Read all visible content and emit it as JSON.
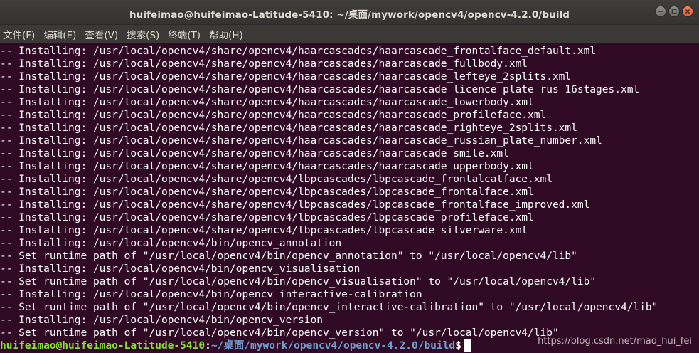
{
  "window": {
    "title": "huifeimao@huifeimao-Latitude-5410: ~/桌面/mywork/opencv4/opencv-4.2.0/build",
    "buttons": [
      {
        "icon": "minimize-icon"
      },
      {
        "icon": "maximize-icon"
      },
      {
        "icon": "close-icon"
      }
    ]
  },
  "menubar": {
    "items": [
      "文件(F)",
      "编辑(E)",
      "查看(V)",
      "搜索(S)",
      "终端(T)",
      "帮助(H)"
    ]
  },
  "terminal": {
    "lines": [
      "-- Installing: /usr/local/opencv4/share/opencv4/haarcascades/haarcascade_frontalface_default.xml",
      "-- Installing: /usr/local/opencv4/share/opencv4/haarcascades/haarcascade_fullbody.xml",
      "-- Installing: /usr/local/opencv4/share/opencv4/haarcascades/haarcascade_lefteye_2splits.xml",
      "-- Installing: /usr/local/opencv4/share/opencv4/haarcascades/haarcascade_licence_plate_rus_16stages.xml",
      "-- Installing: /usr/local/opencv4/share/opencv4/haarcascades/haarcascade_lowerbody.xml",
      "-- Installing: /usr/local/opencv4/share/opencv4/haarcascades/haarcascade_profileface.xml",
      "-- Installing: /usr/local/opencv4/share/opencv4/haarcascades/haarcascade_righteye_2splits.xml",
      "-- Installing: /usr/local/opencv4/share/opencv4/haarcascades/haarcascade_russian_plate_number.xml",
      "-- Installing: /usr/local/opencv4/share/opencv4/haarcascades/haarcascade_smile.xml",
      "-- Installing: /usr/local/opencv4/share/opencv4/haarcascades/haarcascade_upperbody.xml",
      "-- Installing: /usr/local/opencv4/share/opencv4/lbpcascades/lbpcascade_frontalcatface.xml",
      "-- Installing: /usr/local/opencv4/share/opencv4/lbpcascades/lbpcascade_frontalface.xml",
      "-- Installing: /usr/local/opencv4/share/opencv4/lbpcascades/lbpcascade_frontalface_improved.xml",
      "-- Installing: /usr/local/opencv4/share/opencv4/lbpcascades/lbpcascade_profileface.xml",
      "-- Installing: /usr/local/opencv4/share/opencv4/lbpcascades/lbpcascade_silverware.xml",
      "-- Installing: /usr/local/opencv4/bin/opencv_annotation",
      "-- Set runtime path of \"/usr/local/opencv4/bin/opencv_annotation\" to \"/usr/local/opencv4/lib\"",
      "-- Installing: /usr/local/opencv4/bin/opencv_visualisation",
      "-- Set runtime path of \"/usr/local/opencv4/bin/opencv_visualisation\" to \"/usr/local/opencv4/lib\"",
      "-- Installing: /usr/local/opencv4/bin/opencv_interactive-calibration",
      "-- Set runtime path of \"/usr/local/opencv4/bin/opencv_interactive-calibration\" to \"/usr/local/opencv4/lib\"",
      "-- Installing: /usr/local/opencv4/bin/opencv_version",
      "-- Set runtime path of \"/usr/local/opencv4/bin/opencv_version\" to \"/usr/local/opencv4/lib\""
    ],
    "prompt": {
      "user_host": "huifeimao@huifeimao-Latitude-5410",
      "colon": ":",
      "path": "~/桌面/mywork/opencv4/opencv-4.2.0/build",
      "dollar": "$"
    }
  },
  "watermark": "https://blog.csdn.net/mao_hui_fei",
  "colors": {
    "background": "#300a24",
    "prompt_user": "#8ae234",
    "prompt_path": "#729fcf",
    "close_button": "#e8562a"
  }
}
